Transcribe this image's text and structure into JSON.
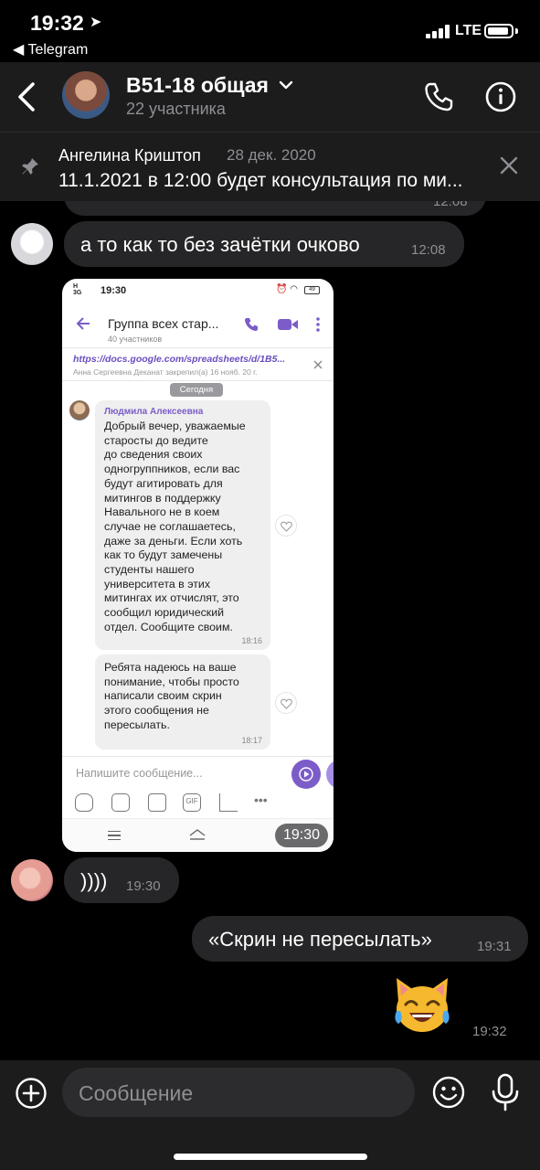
{
  "status_bar": {
    "time": "19:32",
    "back_app": "◀ Telegram",
    "network": "LTE"
  },
  "header": {
    "title": "B51-18 общая",
    "subtitle": "22 участника"
  },
  "pinned": {
    "author": "Ангелина Криштоп",
    "date": "28 дек. 2020",
    "text": "11.1.2021 в 12:00 будет консультация по ми..."
  },
  "messages": [
    {
      "text": "а то как то без зачётки очково",
      "time": "12:08",
      "incoming": true
    },
    {
      "time": "19:30",
      "incoming": true,
      "type": "screenshot"
    },
    {
      "text": "))))",
      "time": "19:30",
      "incoming": true
    },
    {
      "text": "«Скрин не пересылать»",
      "time": "19:31",
      "incoming": false
    },
    {
      "sticker": "crying-laughing-cat",
      "time": "19:32",
      "incoming": false
    }
  ],
  "cut_message_time": "12:08",
  "screenshot": {
    "status_time": "19:30",
    "status_net_top": "H",
    "status_net_bottom": "3G",
    "battery": "49",
    "chat_title": "Группа всех стар...",
    "chat_subtitle": "40 участников",
    "pinned_link": "https://docs.google.com/spreadsheets/d/1B5...",
    "pinned_by": "Анна Сергеевна Деканат закрепил(а) 16 нояб. 20 г.",
    "today_label": "Сегодня",
    "msg1_author": "Людмила Алексеевна",
    "msg1_text": "Добрый вечер, уважаемые\nстаросты до ведите\nдо сведения своих\nодногруппников, если вас\nбудут агитировать для\nмитингов в поддержку\nНавального не в коем\nслучае не соглашаетесь,\nдаже за деньги. Если хоть\nкак то будут замечены\nстуденты нашего\nуниверситета в этих\nмитингах их отчислят, это\nсообщил юридический\nотдел. Сообщите своим.",
    "msg1_time": "18:16",
    "msg2_text": "Ребята надеюсь на ваше\nпонимание, чтобы просто\nнаписали своим скрин\nэтого сообщения не\nпересылать.",
    "msg2_time": "18:17",
    "input_placeholder": "Напишите сообщение..."
  },
  "input": {
    "placeholder": "Сообщение"
  }
}
